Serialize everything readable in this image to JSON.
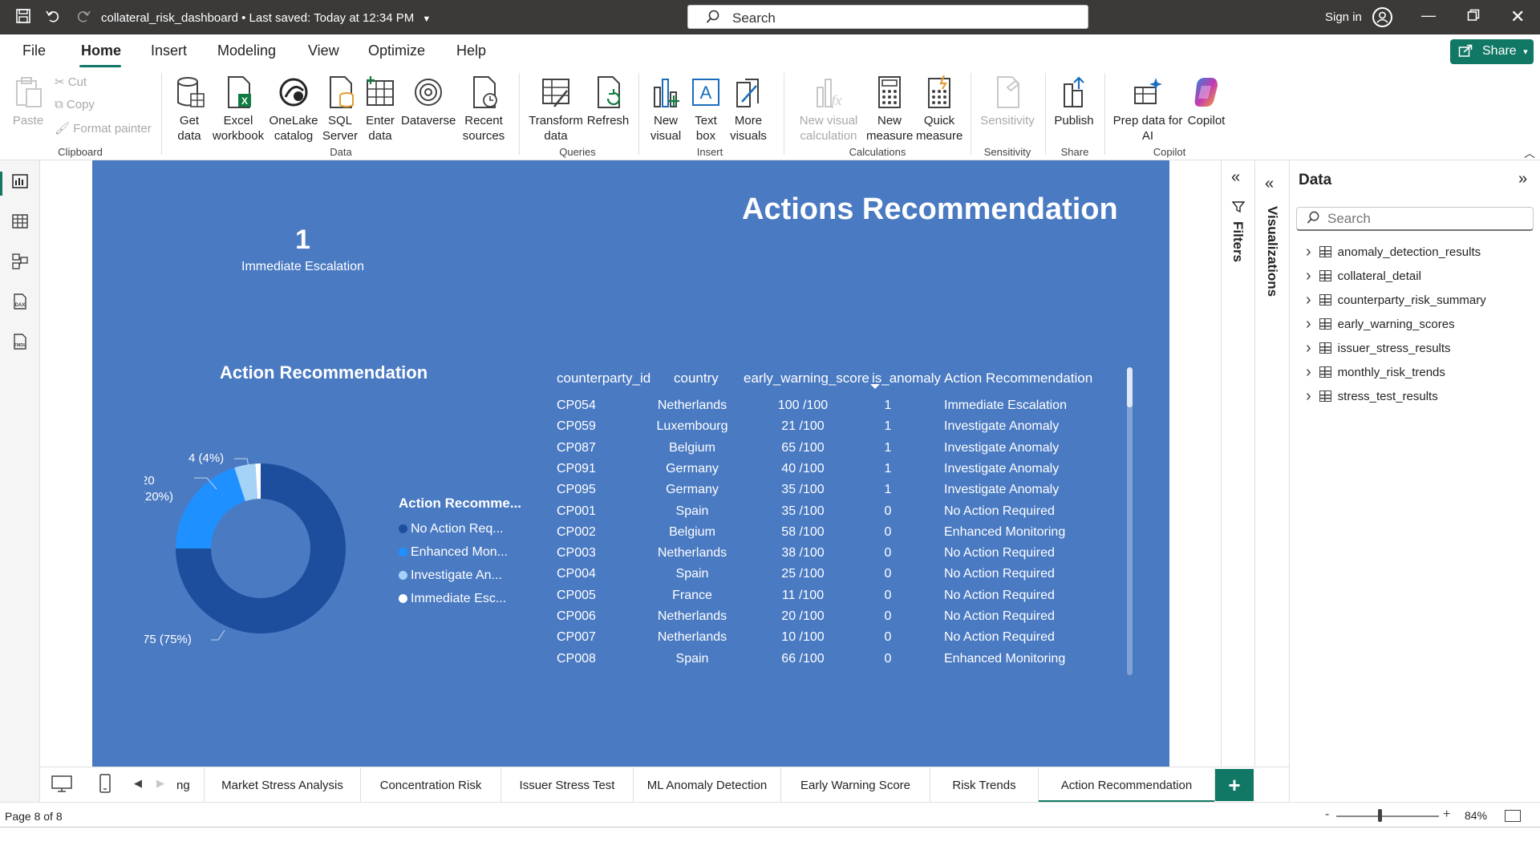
{
  "titlebar": {
    "file_name": "collateral_risk_dashboard",
    "saved_status": "• Last saved: Today at 12:34 PM",
    "search_placeholder": "Search",
    "signin_label": "Sign in"
  },
  "menu": {
    "items": [
      "File",
      "Home",
      "Insert",
      "Modeling",
      "View",
      "Optimize",
      "Help"
    ],
    "active": "Home",
    "share_label": "Share"
  },
  "ribbon": {
    "clipboard": {
      "paste": "Paste",
      "cut": "Cut",
      "copy": "Copy",
      "format_painter": "Format painter",
      "group": "Clipboard"
    },
    "data": {
      "get_data": "Get data",
      "excel": "Excel workbook",
      "onelake": "OneLake catalog",
      "sql": "SQL Server",
      "enter": "Enter data",
      "dataverse": "Dataverse",
      "recent": "Recent sources",
      "group": "Data"
    },
    "queries": {
      "transform": "Transform data",
      "refresh": "Refresh",
      "group": "Queries"
    },
    "insert": {
      "new_visual": "New visual",
      "text_box": "Text box",
      "more_visuals": "More visuals",
      "group": "Insert"
    },
    "calculations": {
      "new_visual_calc": "New visual calculation",
      "new_measure": "New measure",
      "quick_measure": "Quick measure",
      "group": "Calculations"
    },
    "sensitivity": {
      "label": "Sensitivity",
      "group": "Sensitivity"
    },
    "share": {
      "publish": "Publish",
      "group": "Share"
    },
    "copilot": {
      "prep": "Prep data for AI",
      "copilot": "Copilot",
      "group": "Copilot"
    }
  },
  "report": {
    "title": "Actions Recommendation",
    "card": {
      "value": "1",
      "label": "Immediate Escalation"
    },
    "donut_title": "Action Recommendation",
    "legend_title": "Action Recomme...",
    "legend_items": [
      "No Action Req...",
      "Enhanced Mon...",
      "Investigate An...",
      "Immediate Esc..."
    ],
    "table": {
      "headers": [
        "counterparty_id",
        "country",
        "early_warning_score",
        "is_anomaly",
        "Action Recommendation"
      ],
      "rows": [
        [
          "CP054",
          "Netherlands",
          "100 /100",
          "1",
          "Immediate Escalation"
        ],
        [
          "CP059",
          "Luxembourg",
          "21 /100",
          "1",
          "Investigate Anomaly"
        ],
        [
          "CP087",
          "Belgium",
          "65 /100",
          "1",
          "Investigate Anomaly"
        ],
        [
          "CP091",
          "Germany",
          "40 /100",
          "1",
          "Investigate Anomaly"
        ],
        [
          "CP095",
          "Germany",
          "35 /100",
          "1",
          "Investigate Anomaly"
        ],
        [
          "CP001",
          "Spain",
          "35 /100",
          "0",
          "No Action Required"
        ],
        [
          "CP002",
          "Belgium",
          "58 /100",
          "0",
          "Enhanced Monitoring"
        ],
        [
          "CP003",
          "Netherlands",
          "38 /100",
          "0",
          "No Action Required"
        ],
        [
          "CP004",
          "Spain",
          "25 /100",
          "0",
          "No Action Required"
        ],
        [
          "CP005",
          "France",
          "11 /100",
          "0",
          "No Action Required"
        ],
        [
          "CP006",
          "Netherlands",
          "20 /100",
          "0",
          "No Action Required"
        ],
        [
          "CP007",
          "Netherlands",
          "10 /100",
          "0",
          "No Action Required"
        ],
        [
          "CP008",
          "Spain",
          "66 /100",
          "0",
          "Enhanced Monitoring"
        ]
      ]
    }
  },
  "chart_data": {
    "type": "pie",
    "title": "Action Recommendation",
    "categories": [
      "No Action Required",
      "Enhanced Monitoring",
      "Investigate Anomaly",
      "Immediate Escalation"
    ],
    "values": [
      75,
      20,
      4,
      1
    ],
    "data_labels": [
      "75 (75%)",
      "20 (20%)",
      "4 (4%)",
      ""
    ],
    "colors": [
      "#1d4e9e",
      "#1e90ff",
      "#a5d3f7",
      "#ffffff"
    ],
    "legend_placement": "right",
    "donut": true
  },
  "panes": {
    "filters_label": "Filters",
    "visualizations_label": "Visualizations",
    "data_title": "Data",
    "data_search_placeholder": "Search",
    "tables": [
      "anomaly_detection_results",
      "collateral_detail",
      "counterparty_risk_summary",
      "early_warning_scores",
      "issuer_stress_results",
      "monthly_risk_trends",
      "stress_test_results"
    ]
  },
  "page_tabs": {
    "tabs": [
      "ng",
      "Market Stress Analysis",
      "Concentration Risk",
      "Issuer Stress Test",
      "ML Anomaly Detection",
      "Early Warning Score",
      "Risk Trends",
      "Action Recommendation"
    ],
    "active": "Action Recommendation",
    "add_label": "+"
  },
  "statusbar": {
    "page_count": "Page 8 of 8",
    "zoom": "84%",
    "zoom_fraction": 0.42
  }
}
